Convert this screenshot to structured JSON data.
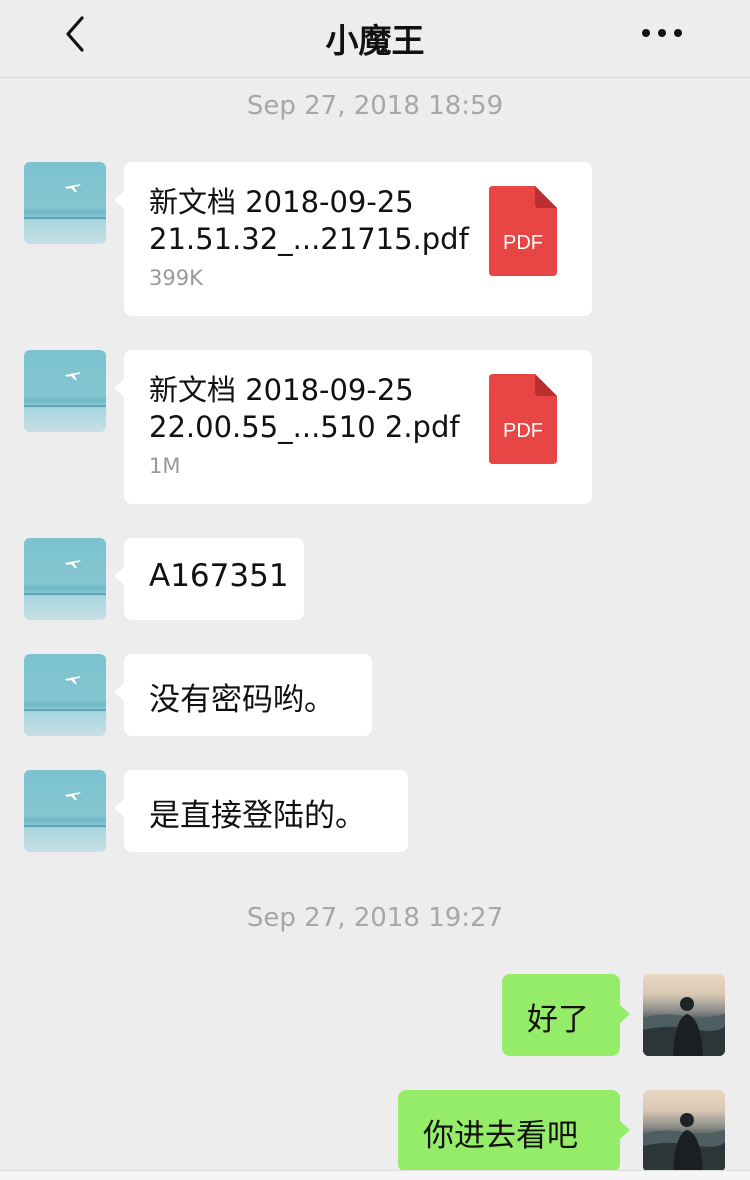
{
  "header": {
    "title": "小魔王",
    "back_icon": "chevron-left-icon",
    "more_icon": "more-horizontal-icon"
  },
  "timestamps": [
    "Sep 27, 2018 18:59",
    "Sep 27, 2018 19:27"
  ],
  "messages": [
    {
      "side": "left",
      "type": "file",
      "file_name_line1": "新文档 2018-09-25",
      "file_name_line2": "21.51.32_...21715.pdf",
      "size": "399K",
      "icon": "PDF"
    },
    {
      "side": "left",
      "type": "file",
      "file_name_line1": "新文档 2018-09-25",
      "file_name_line2": "22.00.55_...510 2.pdf",
      "size": "1M",
      "icon": "PDF"
    },
    {
      "side": "left",
      "type": "text",
      "text": "A167351"
    },
    {
      "side": "left",
      "type": "text",
      "text": "没有密码哟。"
    },
    {
      "side": "left",
      "type": "text",
      "text": "是直接登陆的。"
    },
    {
      "side": "right",
      "type": "text",
      "text": "好了"
    },
    {
      "side": "right",
      "type": "text",
      "text": "你进去看吧"
    }
  ],
  "colors": {
    "background": "#ededed",
    "incoming_bubble": "#ffffff",
    "outgoing_bubble": "#95ec69",
    "pdf_icon": "#e84545",
    "timestamp_text": "#a7a7a7"
  }
}
